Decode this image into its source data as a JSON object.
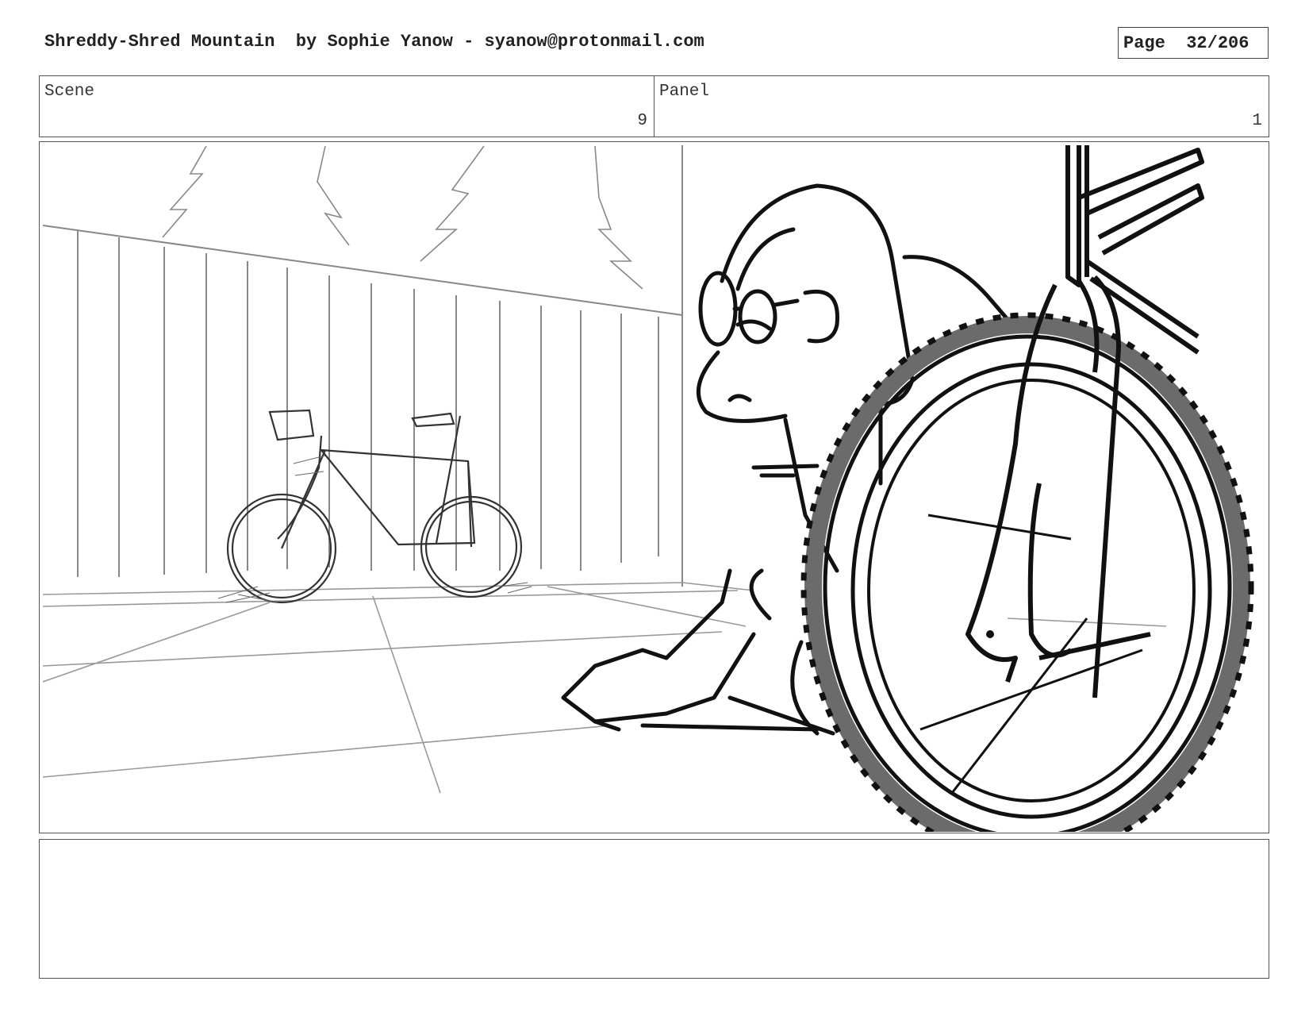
{
  "header": {
    "title": "Shreddy-Shred Mountain  by Sophie Yanow - syanow@protonmail.com",
    "page_label": "Page  32/206"
  },
  "scene": {
    "label": "Scene",
    "value": "9"
  },
  "panel": {
    "label": "Panel",
    "value": "1"
  },
  "notes": {
    "text": ""
  }
}
